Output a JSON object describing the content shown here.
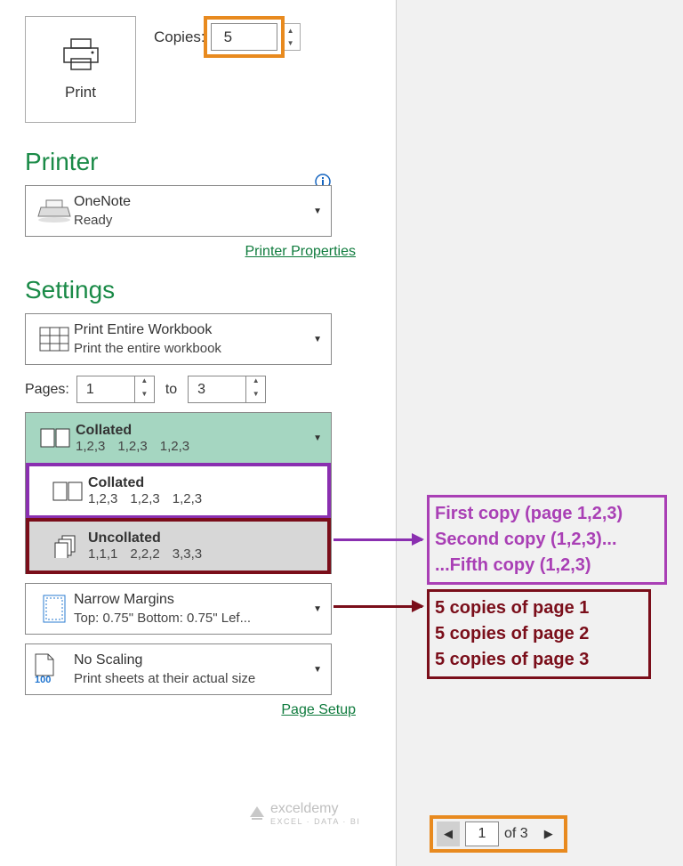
{
  "print": {
    "button_label": "Print"
  },
  "copies": {
    "label": "Copies:",
    "value": "5"
  },
  "printer_section": {
    "title": "Printer",
    "selected_name": "OneNote",
    "selected_status": "Ready",
    "properties_link": "Printer Properties"
  },
  "settings": {
    "title": "Settings",
    "scope": {
      "title": "Print Entire Workbook",
      "subtitle": "Print the entire workbook"
    },
    "pages": {
      "label": "Pages:",
      "from": "1",
      "to_label": "to",
      "to": "3"
    },
    "collation_selected": {
      "title": "Collated",
      "pattern": [
        "1,2,3",
        "1,2,3",
        "1,2,3"
      ]
    },
    "collation_options": [
      {
        "title": "Collated",
        "pattern": [
          "1,2,3",
          "1,2,3",
          "1,2,3"
        ]
      },
      {
        "title": "Uncollated",
        "pattern": [
          "1,1,1",
          "2,2,2",
          "3,3,3"
        ]
      }
    ],
    "margins": {
      "title": "Narrow Margins",
      "subtitle": "Top: 0.75\" Bottom: 0.75\" Lef..."
    },
    "scaling": {
      "title": "No Scaling",
      "subtitle": "Print sheets at their actual size",
      "icon_num": "100"
    },
    "page_setup_link": "Page Setup"
  },
  "annotations": {
    "collated": [
      "First copy (page 1,2,3)",
      "Second copy (1,2,3)...",
      "...Fifth copy (1,2,3)"
    ],
    "uncollated": [
      "5 copies of page 1",
      "5 copies of page 2",
      "5 copies of page 3"
    ]
  },
  "preview_nav": {
    "current": "1",
    "of_label": "of 3"
  },
  "watermark": {
    "brand": "exceldemy",
    "tagline": "EXCEL · DATA · BI"
  }
}
